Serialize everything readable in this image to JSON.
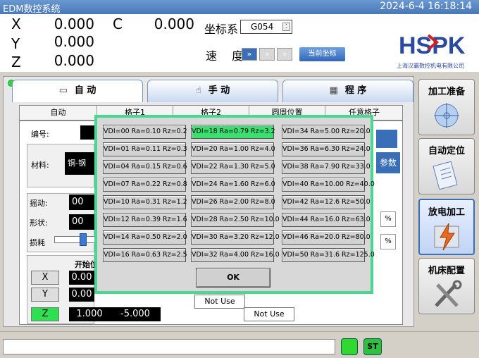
{
  "titlebar": {
    "app": "EDM数控系统",
    "datetime": "2024-6-4 16:18:14"
  },
  "coords": [
    {
      "label": "X",
      "value": "0.000"
    },
    {
      "label": "Y",
      "value": "0.000"
    },
    {
      "label": "Z",
      "value": "0.000"
    },
    {
      "label": "C",
      "value": "0.000"
    }
  ],
  "coordsys": {
    "label": "坐标系",
    "value": "G054"
  },
  "speed": {
    "label": "速 度",
    "steps": [
      "»",
      "»",
      "»"
    ],
    "level": "1 of 3"
  },
  "current_coord_button": "当前坐标",
  "logo": {
    "text": "HSPK",
    "company": "上海汉霸数控机电有限公司"
  },
  "tabs": [
    "自 动",
    "手 动",
    "程 序"
  ],
  "subtabs": [
    "自动",
    "格子1",
    "格子2",
    "圆周位置",
    "任意格子"
  ],
  "form": {
    "number_label": "编号:",
    "material_label": "材料:",
    "material_value": "铜-钢",
    "swing_label": "摇动:",
    "swing_value": "00",
    "shape_label": "形状:",
    "shape_value": "00",
    "wear_label": "损耗",
    "start_label": "开始位",
    "params_label": "参数",
    "percent": "%"
  },
  "axes": [
    {
      "label": "X",
      "v1": "0.00",
      "v2": ""
    },
    {
      "label": "Y",
      "v1": "0.00",
      "v2": ""
    },
    {
      "label": "Z",
      "v1": "1.000",
      "v2": "-5.000"
    }
  ],
  "not_use": [
    "Not Use",
    "Not Use"
  ],
  "dialog": {
    "items": [
      "VDI=00 Ra=0.10 Rz=0.2",
      "VDI=18 Ra=0.79 Rz=3.2",
      "VDI=34 Ra=5.00 Rz=20.0",
      "VDI=01 Ra=0.11 Rz=0.3",
      "VDI=20 Ra=1.00 Rz=4.0",
      "VDI=36 Ra=6.30 Rz=24.0",
      "VDI=04 Ra=0.15 Rz=0.6",
      "VDI=22 Ra=1.30 Rz=5.0",
      "VDI=38 Ra=7.90 Rz=33.0",
      "VDI=07 Ra=0.22 Rz=0.8",
      "VDI=24 Ra=1.60 Rz=6.0",
      "VDI=40 Ra=10.00 Rz=40.0",
      "VDI=10 Ra=0.31 Rz=1.2",
      "VDI=26 Ra=2.00 Rz=8.0",
      "VDI=42 Ra=12.6 Rz=50.0",
      "VDI=12 Ra=0.39 Rz=1.6",
      "VDI=28 Ra=2.50 Rz=10.0",
      "VDI=44 Ra=16.0 Rz=63.0",
      "VDI=14 Ra=0.50 Rz=2.0",
      "VDI=30 Ra=3.20 Rz=12.0",
      "VDI=46 Ra=20.0 Rz=80.0",
      "VDI=16 Ra=0.63 Rz=2.5",
      "VDI=32 Ra=4.00 Rz=16.0",
      "VDI=50 Ra=31.6 Rz=125.0"
    ],
    "selected": "VDI=18 Ra=0.79 Rz=3.2",
    "ok": "OK"
  },
  "side": [
    "加工准备",
    "自动定位",
    "放电加工",
    "机床配置"
  ],
  "status": {
    "st": "ST"
  }
}
